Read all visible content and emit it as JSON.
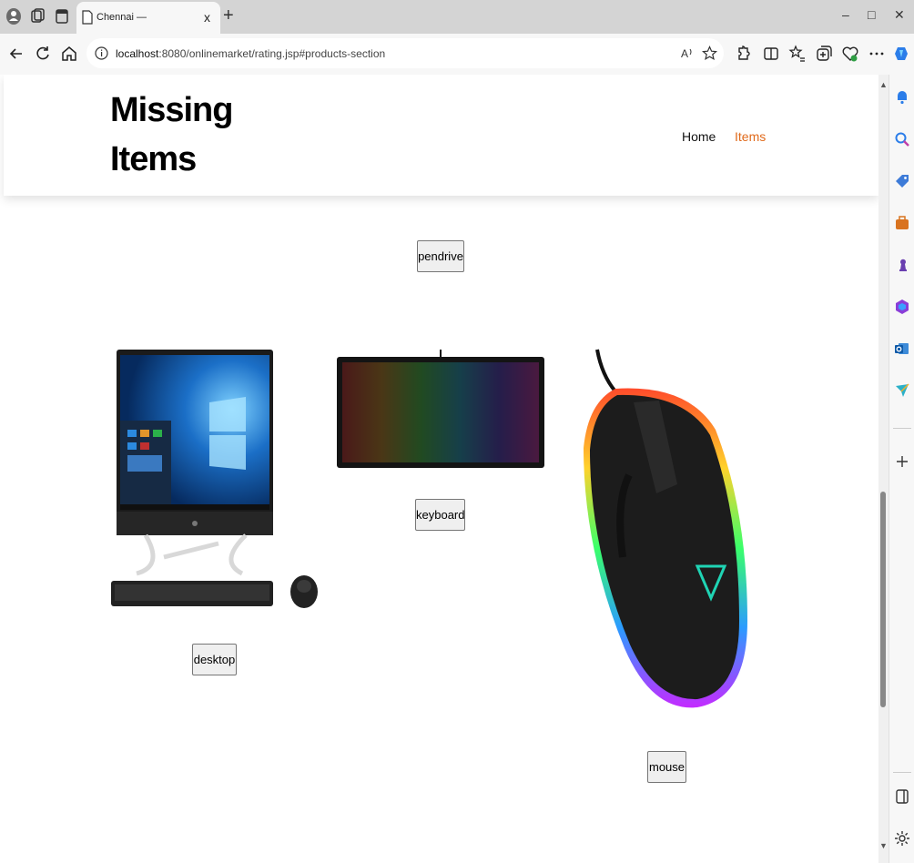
{
  "browser": {
    "tab_title": "Chennai —",
    "tab_close": "x",
    "new_tab": "+",
    "url_host": "localhost",
    "url_rest": ":8080/onlinemarket/rating.jsp#products-section",
    "window_controls": {
      "minimize": "–",
      "maximize": "□",
      "close": "✕"
    }
  },
  "page": {
    "logo_line1": "Missing",
    "logo_line2": "Items",
    "nav": {
      "home": "Home",
      "items": "Items"
    },
    "products": [
      {
        "label": "pendrive",
        "icon": "pendrive-image"
      },
      {
        "label": "desktop",
        "icon": "desktop-computer-image"
      },
      {
        "label": "keyboard",
        "icon": "rgb-keyboard-image"
      },
      {
        "label": "mouse",
        "icon": "rgb-gaming-mouse-image"
      }
    ]
  },
  "colors": {
    "accent_nav": "#e06a1b",
    "tabbar": "#d4d4d4",
    "toolbar": "#f7f7f7"
  }
}
